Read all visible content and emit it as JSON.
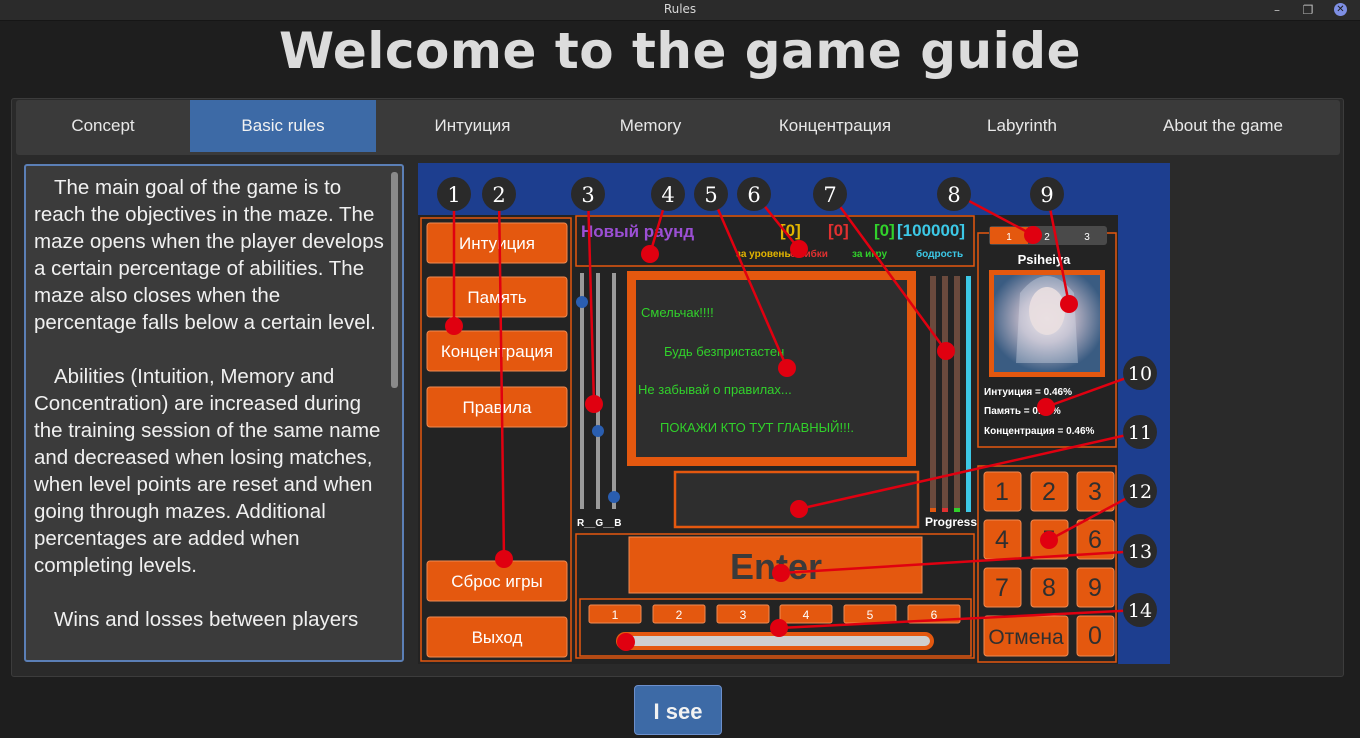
{
  "window": {
    "title": "Rules",
    "minimize_glyph": "–",
    "restore_glyph": "❐",
    "close_glyph": "✕"
  },
  "heading": "Welcome to the game guide",
  "tabs": [
    {
      "label": "Concept",
      "active": false
    },
    {
      "label": "Basic rules",
      "active": true
    },
    {
      "label": "Интуиция",
      "active": false
    },
    {
      "label": "Memory",
      "active": false
    },
    {
      "label": "Концентрация",
      "active": false
    },
    {
      "label": "Labyrinth",
      "active": false
    },
    {
      "label": "About the game",
      "active": false
    }
  ],
  "rules_text": [
    "The main goal of the game is to reach the objectives in the maze. The maze opens when the player develops a certain percentage of abilities. The maze also closes when the percentage falls below a certain level.",
    "Abilities (Intuition, Memory and Concentration) are increased during the training session of the same name and decreased when losing matches, when level points are reset and when going through mazes. Additional percentages are added when completing levels.",
    "Wins and losses between players"
  ],
  "game": {
    "menu_buttons": [
      "Интуиция",
      "Память",
      "Концентрация",
      "Правила"
    ],
    "reset_button": "Сброс игры",
    "exit_button": "Выход",
    "round_label": "Новый раунд",
    "counters": [
      "[0]",
      "[0]",
      "[0]",
      "[100000]"
    ],
    "counter_labels": [
      "за уровень",
      "ошибки",
      "за игру",
      "бодрость"
    ],
    "messages": [
      "Смельчак!!!!",
      "Будь безпристастен",
      "Не забывай о правилах...",
      "ПОКАЖИ КТО ТУТ ГЛАВНЫЙ!!!."
    ],
    "slider_label": "R__G__B",
    "progress_label": "Progress",
    "enter_button": "Enter",
    "level_buttons": [
      "1",
      "2",
      "3",
      "4",
      "5",
      "6"
    ],
    "player_tabs": [
      "1",
      "2",
      "3"
    ],
    "player_name": "Psiheiya",
    "stats": [
      "Интуиция = 0.46%",
      "Память = 0.46%",
      "Концентрация = 0.46%"
    ],
    "keypad": [
      "1",
      "2",
      "3",
      "4",
      "5",
      "6",
      "7",
      "8",
      "9"
    ],
    "cancel_key": "Отмена",
    "zero_key": "0",
    "markers": [
      "1",
      "2",
      "3",
      "4",
      "5",
      "6",
      "7",
      "8",
      "9",
      "10",
      "11",
      "12",
      "13",
      "14"
    ],
    "colors": {
      "orange": "#e4580f",
      "marker_red": "#e00010",
      "green_text": "#31d12b",
      "purple": "#9b4fd4",
      "yellow": "#e2b400",
      "red": "#e03030",
      "cyan": "#3cc8e6"
    }
  },
  "ok_button": "I see"
}
